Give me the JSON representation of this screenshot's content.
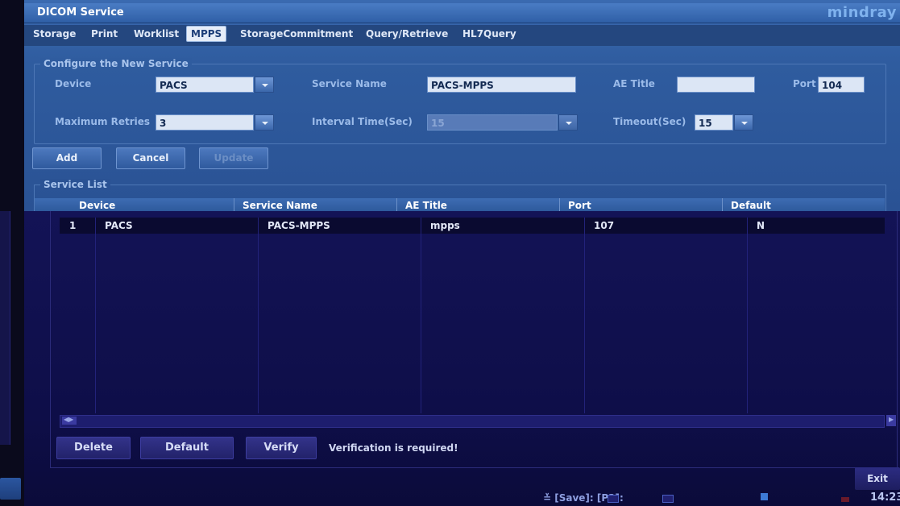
{
  "window": {
    "title": "DICOM Service",
    "brand": "mindray"
  },
  "tabs": [
    {
      "label": "Storage"
    },
    {
      "label": "Print"
    },
    {
      "label": "Worklist"
    },
    {
      "label": "MPPS"
    },
    {
      "label": "StorageCommitment"
    },
    {
      "label": "Query/Retrieve"
    },
    {
      "label": "HL7Query"
    }
  ],
  "active_tab": "MPPS",
  "config": {
    "legend": "Configure the New Service",
    "device_label": "Device",
    "device_value": "PACS",
    "service_name_label": "Service Name",
    "service_name_value": "PACS-MPPS",
    "ae_title_label": "AE Title",
    "ae_title_value": "",
    "port_label": "Port",
    "port_value": "104",
    "max_retries_label": "Maximum Retries",
    "max_retries_value": "3",
    "interval_label": "Interval Time(Sec)",
    "interval_value": "15",
    "timeout_label": "Timeout(Sec)",
    "timeout_value": "15"
  },
  "actions": {
    "add": "Add",
    "cancel": "Cancel",
    "update": "Update"
  },
  "service_list": {
    "legend": "Service List",
    "columns": [
      "Device",
      "Service Name",
      "AE Title",
      "Port",
      "Default"
    ],
    "rows": [
      {
        "index": "1",
        "device": "PACS",
        "service_name": "PACS-MPPS",
        "ae_title": "mpps",
        "port": "107",
        "default": "N"
      }
    ]
  },
  "bottom_actions": {
    "delete": "Delete",
    "default": "Default",
    "verify": "Verify"
  },
  "verify_message": "Verification is required!",
  "exit": "Exit",
  "status_bar": {
    "text": "[Save]:    [P2]:",
    "time": "14:23"
  },
  "colors": {
    "upper_bg": "#2f5c9f",
    "lower_bg": "#131356",
    "accent": "#7fb2ee"
  }
}
